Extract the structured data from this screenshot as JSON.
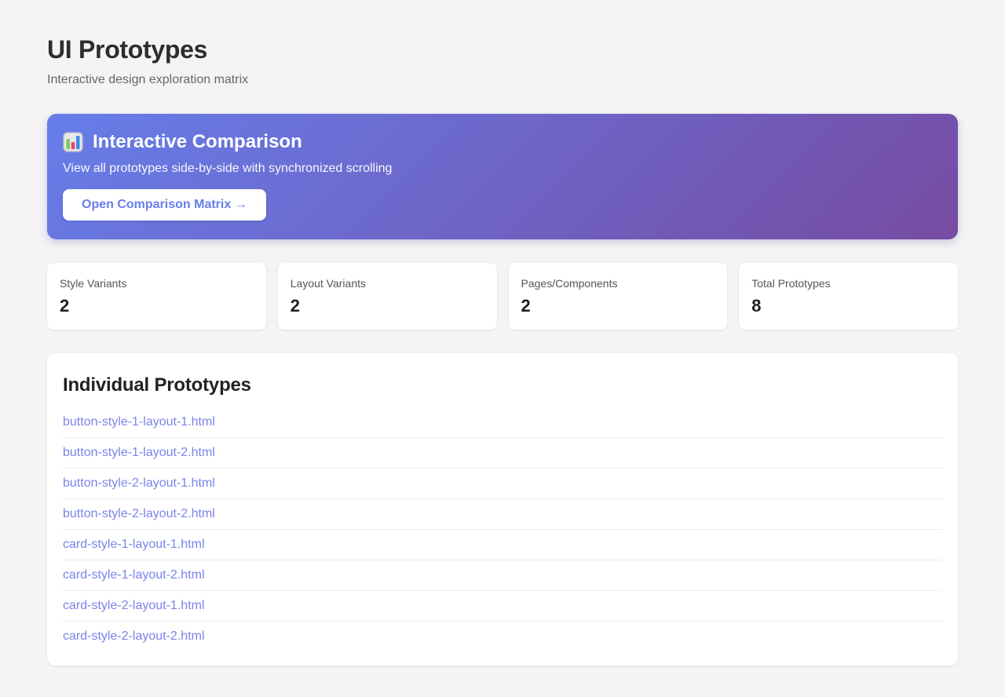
{
  "page": {
    "title": "UI Prototypes",
    "subtitle": "Interactive design exploration matrix"
  },
  "banner": {
    "icon": "bar-chart-emoji",
    "title": "Interactive Comparison",
    "description": "View all prototypes side-by-side with synchronized scrolling",
    "button_label": "Open Comparison Matrix →"
  },
  "stats": [
    {
      "label": "Style Variants",
      "value": "2"
    },
    {
      "label": "Layout Variants",
      "value": "2"
    },
    {
      "label": "Pages/Components",
      "value": "2"
    },
    {
      "label": "Total Prototypes",
      "value": "8"
    }
  ],
  "prototypes": {
    "title": "Individual Prototypes",
    "links": [
      "button-style-1-layout-1.html",
      "button-style-1-layout-2.html",
      "button-style-2-layout-1.html",
      "button-style-2-layout-2.html",
      "card-style-1-layout-1.html",
      "card-style-1-layout-2.html",
      "card-style-2-layout-1.html",
      "card-style-2-layout-2.html"
    ]
  },
  "colors": {
    "accent": "#667eea",
    "link": "#7b84e8",
    "gradient_start": "#667eea",
    "gradient_end": "#764ba2",
    "page_bg": "#f4f4f5"
  }
}
